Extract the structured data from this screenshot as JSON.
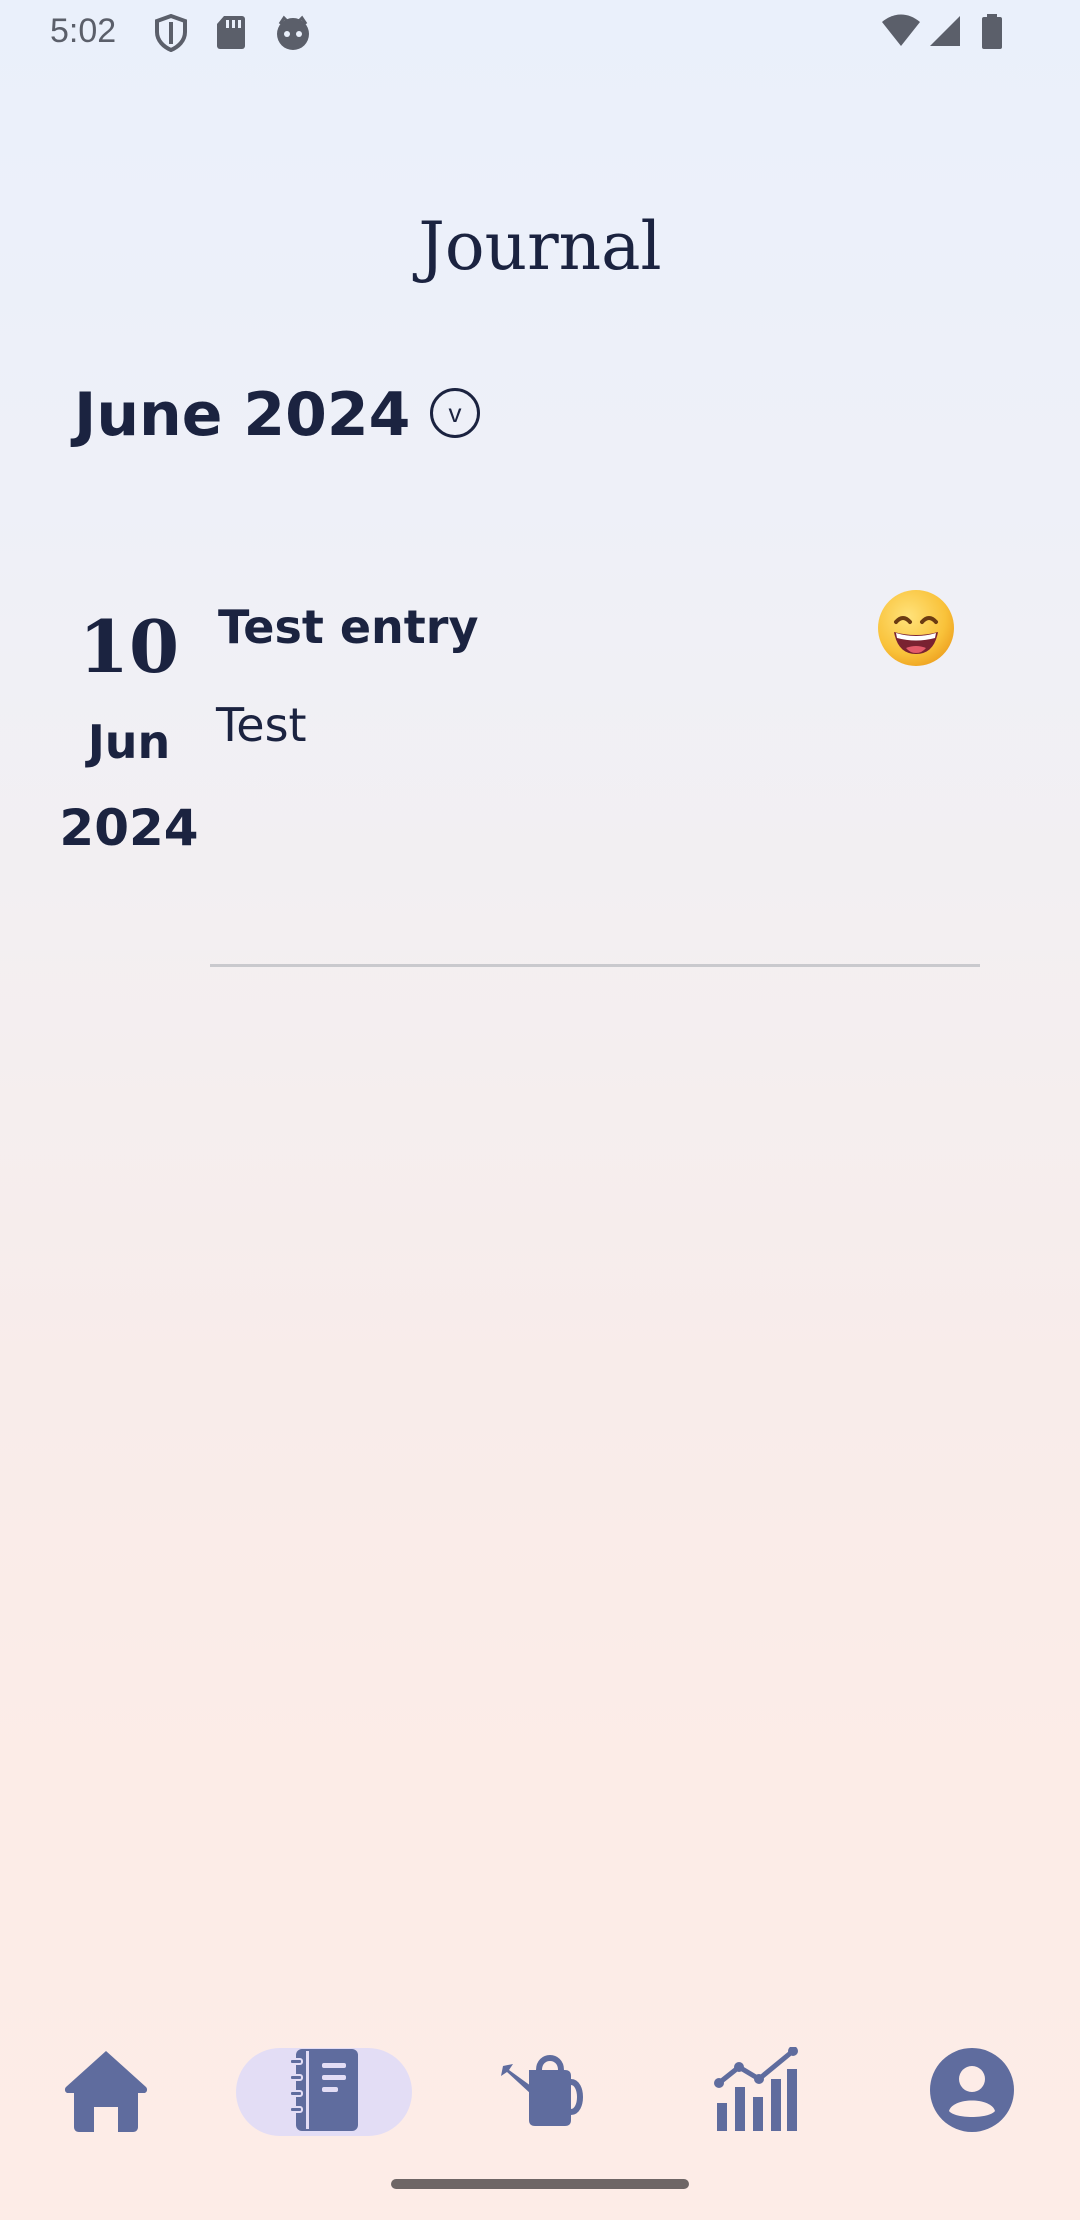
{
  "status_bar": {
    "time": "5:02",
    "icons": [
      "shield-icon",
      "sd-card-icon",
      "face-icon",
      "wifi-icon",
      "cellular-icon",
      "battery-icon"
    ]
  },
  "header": {
    "title": "Journal"
  },
  "month_selector": {
    "label": "June 2024",
    "toggle_glyph": "v"
  },
  "entries": [
    {
      "day": "10",
      "month": "Jun",
      "year": "2024",
      "title": "Test entry",
      "body": "Test",
      "mood_icon": "grinning-face-emoji"
    }
  ],
  "bottom_nav": {
    "items": [
      "home-icon",
      "journal-icon",
      "watering-can-icon",
      "stats-icon",
      "account-icon"
    ],
    "active_index": 1,
    "colors": {
      "icon": "#5f6c9e",
      "active_pill": "#e3ddf5"
    }
  },
  "colors": {
    "text": "#1b2340",
    "divider": "#c9c9cd"
  }
}
